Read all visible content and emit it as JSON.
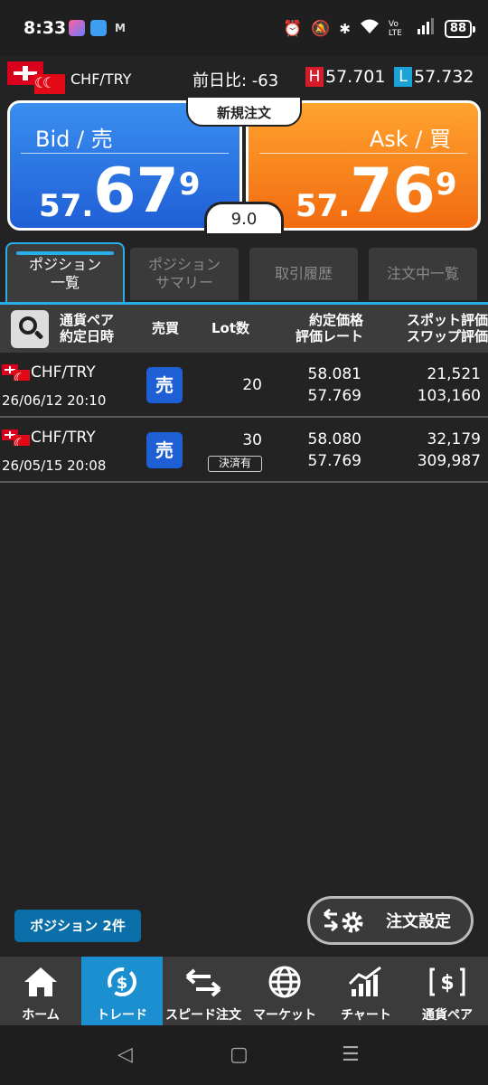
{
  "status_bar": {
    "time": "8:33",
    "apps": [
      "M"
    ],
    "network": "Vo LTE",
    "battery": "88"
  },
  "pair_header": {
    "pair": "CHF/TRY",
    "day_change": "前日比: -63",
    "high_tag": "H",
    "high": "57.701",
    "low_tag": "L",
    "low": "57.732",
    "colors": {
      "high_tag": "#d81b2a",
      "low_tag": "#1ba3d8"
    }
  },
  "quote": {
    "bid_label": "Bid / 売",
    "bid_prefix": "57.",
    "bid_big": "67",
    "bid_pip": "9",
    "ask_label": "Ask / 買",
    "ask_prefix": "57.",
    "ask_big": "76",
    "ask_pip": "9",
    "new_order": "新規注文",
    "spread": "9.0",
    "colors": {
      "bid": "#2f7be8",
      "ask": "#f7891e"
    }
  },
  "tabs": [
    {
      "label_1": "ポジション",
      "label_2": "一覧"
    },
    {
      "label_1": "ポジション",
      "label_2": "サマリー"
    },
    {
      "label_1": "取引履歴",
      "label_2": ""
    },
    {
      "label_1": "注文中一覧",
      "label_2": ""
    }
  ],
  "list_header": {
    "pair_1": "通貨ペア",
    "pair_2": "約定日時",
    "side": "売買",
    "lot": "Lot数",
    "price_1": "約定価格",
    "price_2": "評価レート",
    "eval_1": "スポット評価",
    "eval_2": "スワップ評価"
  },
  "positions": [
    {
      "pair": "CHF/TRY",
      "date": "26/06/12 20:10",
      "side": "売",
      "lot": "20",
      "settled": "",
      "price": "58.081",
      "rate": "57.769",
      "spot": "21,521",
      "swap": "103,160"
    },
    {
      "pair": "CHF/TRY",
      "date": "26/05/15 20:08",
      "side": "売",
      "lot": "30",
      "settled": "決済有",
      "price": "58.080",
      "rate": "57.769",
      "spot": "32,179",
      "swap": "309,987"
    }
  ],
  "footer": {
    "position_count": "ポジション 2件",
    "order_settings": "注文設定"
  },
  "nav": [
    {
      "label": "ホーム",
      "icon": "home-icon"
    },
    {
      "label": "トレード",
      "icon": "trade-icon"
    },
    {
      "label": "スピード注文",
      "icon": "speed-order-icon"
    },
    {
      "label": "マーケット",
      "icon": "globe-icon"
    },
    {
      "label": "チャート",
      "icon": "chart-icon"
    },
    {
      "label": "通貨ペア",
      "icon": "currency-icon"
    }
  ],
  "system_nav": {
    "back": "◁",
    "home": "▢",
    "recents": "☰"
  }
}
